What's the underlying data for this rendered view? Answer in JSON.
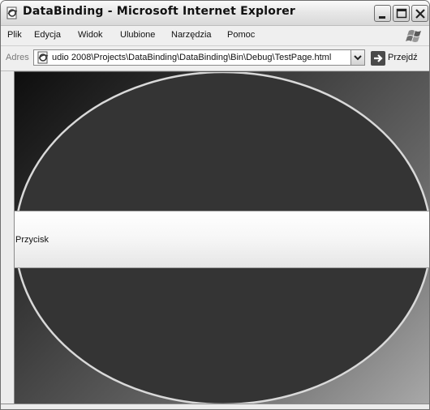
{
  "window": {
    "title": "DataBinding - Microsoft Internet Explorer"
  },
  "menu": {
    "items": [
      {
        "label": "Plik"
      },
      {
        "label": "Edycja"
      },
      {
        "label": "Widok"
      },
      {
        "label": "Ulubione"
      },
      {
        "label": "Narzędzia"
      },
      {
        "label": "Pomoc"
      }
    ]
  },
  "address_bar": {
    "label": "Adres",
    "value": "udio 2008\\Projects\\DataBinding\\DataBinding\\Bin\\Debug\\TestPage.html",
    "go_label": "Przejdź"
  },
  "content": {
    "button_label": "Przycisk"
  },
  "icons": {
    "title": "ie-page-icon",
    "address": "ie-page-icon",
    "go": "go-arrow-icon",
    "logo": "windows-flag-icon"
  },
  "colors": {
    "ellipse_fill": "#343434",
    "ellipse_stroke": "#d9d9d9"
  }
}
